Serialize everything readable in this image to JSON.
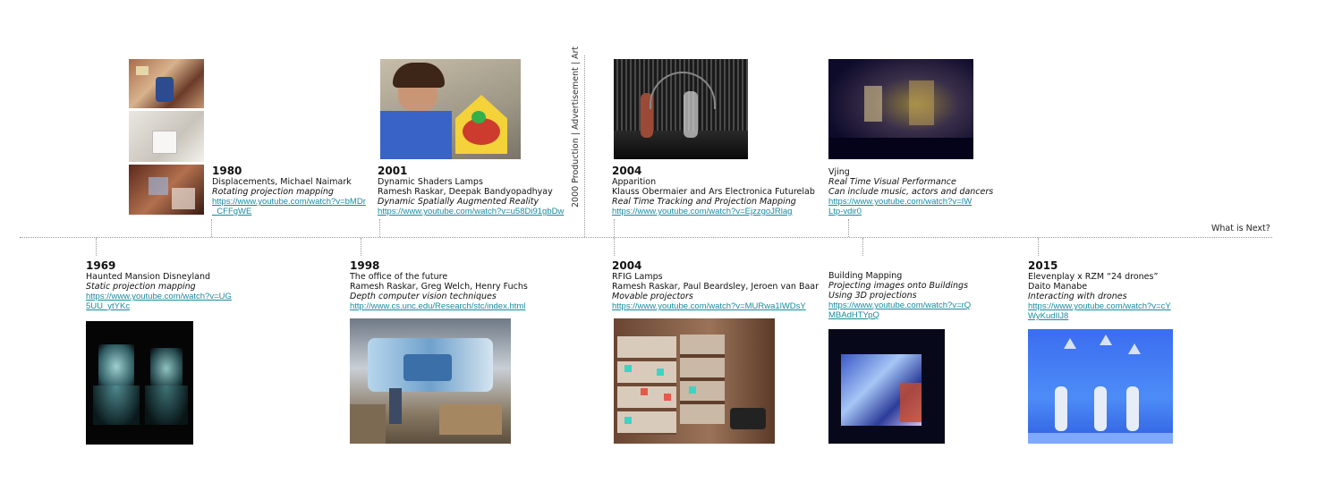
{
  "divider_label": "2000 Production | Advertisement | Art",
  "next_label": "What is Next?",
  "entries": {
    "e1980": {
      "year": "1980",
      "title": "Displacements, Michael Naimark",
      "subtitle": "Rotating projection mapping",
      "link1": "https://www.youtube.com/watch?v=bMDr",
      "link2": "_CFFgWE"
    },
    "e2001": {
      "year": "2001",
      "title": "Dynamic Shaders Lamps",
      "authors": "Ramesh Raskar, Deepak Bandyopadhyay",
      "subtitle": "Dynamic Spatially Augmented Reality",
      "link1": "https://www.youtube.com/watch?v=u58Di91gbDw"
    },
    "e2004a": {
      "year": "2004",
      "title": "Apparition",
      "authors": "Klauss Obermaier and Ars Electronica Futurelab",
      "subtitle": "Real Time Tracking and Projection Mapping",
      "link1": "https://www.youtube.com/watch?v=EjzzgoJRlag"
    },
    "evjing": {
      "title": "Vjing",
      "subtitle": "Real Time Visual Performance",
      "subtitle2": "Can include music, actors and dancers",
      "link1": "https://www.youtube.com/watch?v=IW",
      "link2": "Ltp-vdir0"
    },
    "e1969": {
      "year": "1969",
      "title": "Haunted Mansion Disneyland",
      "subtitle": "Static projection mapping",
      "link1": "https://www.youtube.com/watch?v=UG",
      "link2": "5UU_ytYKc"
    },
    "e1998": {
      "year": "1998",
      "title": "The office of the future",
      "authors": "Ramesh Raskar, Greg Welch, Henry Fuchs",
      "subtitle": "Depth computer vision techniques",
      "link1": "http://www.cs.unc.edu/Research/stc/index.html"
    },
    "e2004b": {
      "year": "2004",
      "title": "RFIG Lamps",
      "authors": "Ramesh Raskar, Paul Beardsley, Jeroen van Baar",
      "subtitle": "Movable projectors",
      "link1": "https://www.youtube.com/watch?v=MURwa1lWDsY"
    },
    "ebuilding": {
      "title": "Building Mapping",
      "subtitle": "Projecting images onto Buildings",
      "subtitle2": "Using 3D projections",
      "link1": "https://www.youtube.com/watch?v=rQ",
      "link2": "MBAdHTYpQ"
    },
    "e2015": {
      "year": "2015",
      "title": "Elevenplay x RZM “24 drones”",
      "authors": "Daito Manabe",
      "subtitle": "Interacting with drones",
      "link1": "https://www.youtube.com/watch?v=cY",
      "link2": "WyKudIlJ8"
    }
  }
}
